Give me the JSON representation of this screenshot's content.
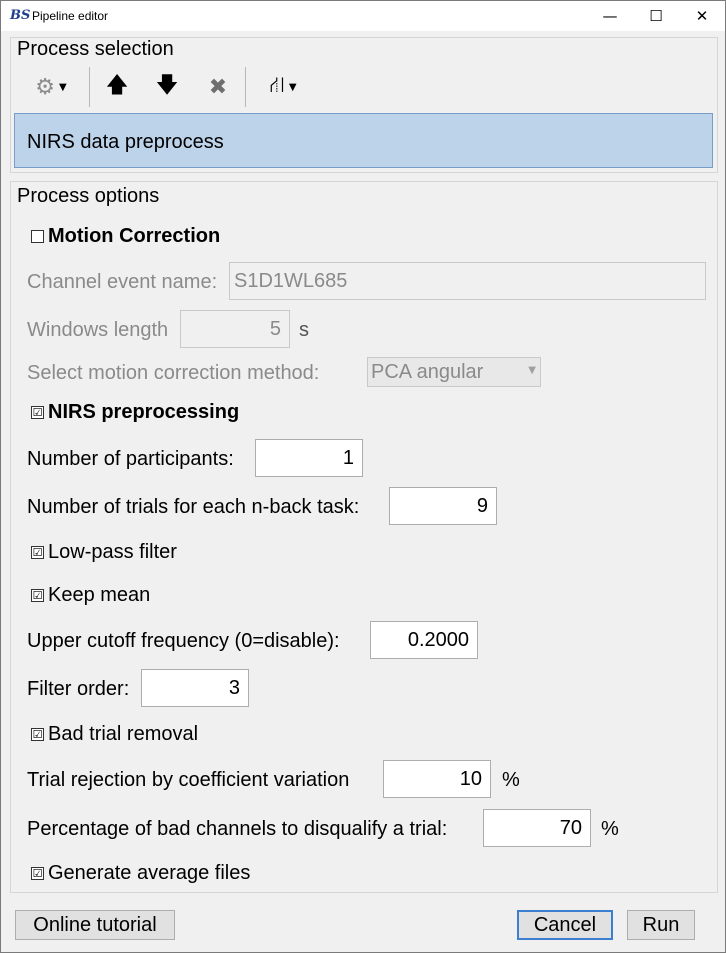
{
  "window": {
    "title": "Pipeline editor",
    "app_icon": "BS",
    "controls": {
      "minimize": "—",
      "maximize": "☐",
      "close": "✕"
    }
  },
  "process_selection": {
    "title": "Process selection",
    "toolbar": [
      {
        "name": "gear-icon",
        "glyph": "⚙",
        "has_dropdown": true
      },
      {
        "name": "arrow-up-icon",
        "glyph": "🡅"
      },
      {
        "name": "arrow-down-icon",
        "glyph": "🡇"
      },
      {
        "name": "delete-icon",
        "glyph": "✖"
      },
      {
        "name": "pipeline-icon",
        "glyph": "⛙",
        "has_dropdown": true
      }
    ],
    "selected_process": "NIRS data preprocess"
  },
  "process_options": {
    "title": "Process options",
    "motion_correction": {
      "label": "Motion Correction",
      "checked": false
    },
    "channel_event_name": {
      "label": "Channel event name:",
      "value": "S1D1WL685"
    },
    "windows_length": {
      "label": "Windows length",
      "value": "5",
      "unit": "s"
    },
    "motion_method": {
      "label": "Select motion correction method:",
      "value": "PCA angular"
    },
    "nirs_preprocessing": {
      "label": "NIRS preprocessing",
      "checked": true
    },
    "num_participants": {
      "label": "Number of participants:",
      "value": "1"
    },
    "num_trials": {
      "label": "Number of trials for each n-back task:",
      "value": "9"
    },
    "low_pass_filter": {
      "label": "Low-pass filter",
      "checked": true
    },
    "keep_mean": {
      "label": "Keep mean",
      "checked": true
    },
    "upper_cutoff": {
      "label": "Upper cutoff frequency (0=disable):",
      "value": "0.2000"
    },
    "filter_order": {
      "label": "Filter order:",
      "value": "3"
    },
    "bad_trial_removal": {
      "label": "Bad trial removal",
      "checked": true
    },
    "trial_rejection": {
      "label": "Trial rejection by coefficient variation",
      "value": "10",
      "unit": "%"
    },
    "bad_channels_pct": {
      "label": "Percentage of bad channels to disqualify a trial:",
      "value": "70",
      "unit": "%"
    },
    "generate_average": {
      "label": "Generate average files",
      "checked": true
    }
  },
  "buttons": {
    "online_tutorial": "Online tutorial",
    "cancel": "Cancel",
    "run": "Run"
  },
  "check_glyph": "☑",
  "colors": {
    "selection_bg": "#bdd3ea",
    "accent": "#3c7fd1"
  }
}
